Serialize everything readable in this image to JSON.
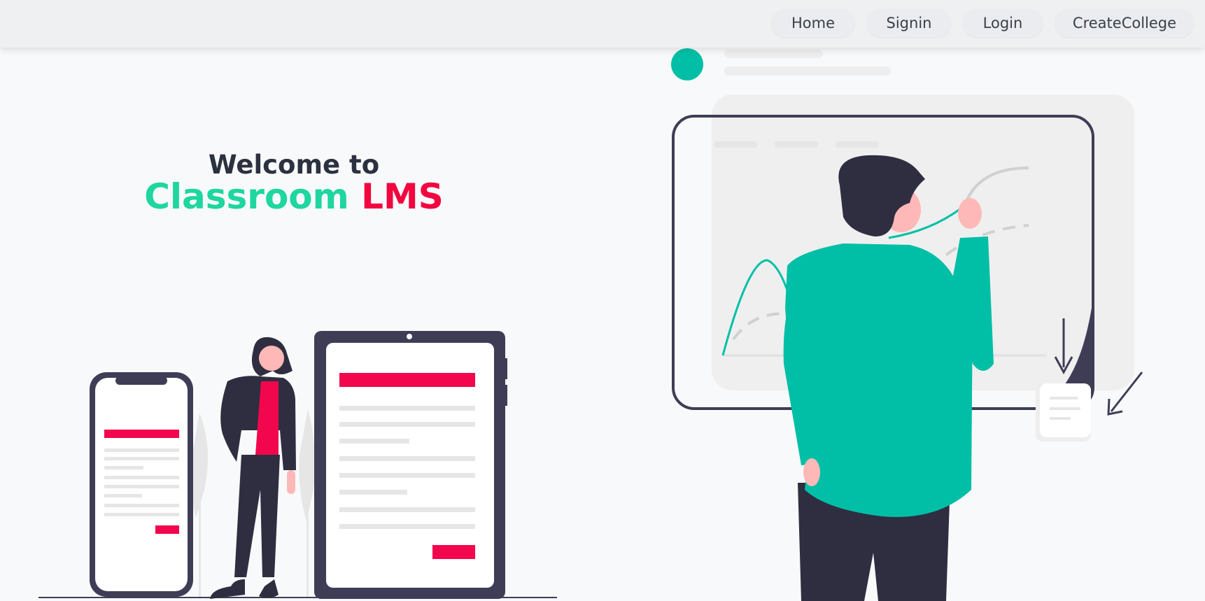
{
  "nav": {
    "items": [
      {
        "label": "Home"
      },
      {
        "label": "Signin"
      },
      {
        "label": "Login"
      },
      {
        "label": "CreateCollege"
      }
    ]
  },
  "hero": {
    "welcome": "Welcome to",
    "brand_part1": "Classroom",
    "brand_part2": "LMS"
  },
  "colors": {
    "accent_green": "#00bfa6",
    "brand_green": "#1ed6a0",
    "brand_red": "#f2063f",
    "dark": "#3f3d56",
    "navbar_bg": "#eef0f2"
  }
}
